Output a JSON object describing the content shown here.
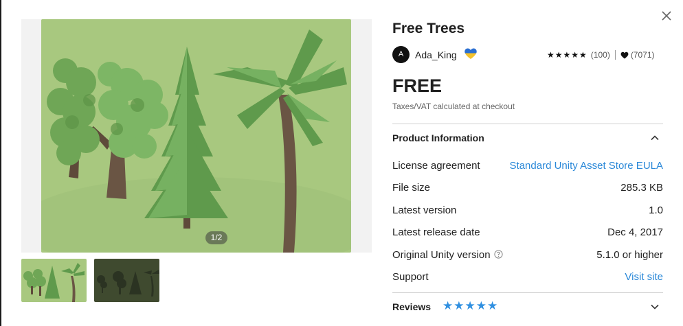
{
  "product": {
    "title": "Free Trees",
    "publisher": "Ada_King",
    "avatar_initial": "A",
    "rating_stars": "★★★★★",
    "rating_count": "(100)",
    "favorites_count": "(7071)",
    "price": "FREE",
    "tax_note": "Taxes/VAT calculated at checkout"
  },
  "gallery": {
    "counter": "1/2"
  },
  "product_information": {
    "heading": "Product Information",
    "rows": [
      {
        "label": "License agreement",
        "value": "Standard Unity Asset Store EULA"
      },
      {
        "label": "File size",
        "value": "285.3 KB"
      },
      {
        "label": "Latest version",
        "value": "1.0"
      },
      {
        "label": "Latest release date",
        "value": "Dec 4, 2017"
      },
      {
        "label": "Original Unity version",
        "value": "5.1.0 or higher"
      },
      {
        "label": "Support",
        "value": "Visit site"
      }
    ]
  },
  "reviews": {
    "heading": "Reviews",
    "stars": "★★★★★"
  },
  "icons": {
    "close": "close-icon",
    "flag": "ukraine-heart-icon",
    "heart": "heart-icon",
    "help": "help-icon",
    "chevron_up": "chevron-up-icon",
    "chevron_down": "chevron-down-icon"
  },
  "colors": {
    "link": "#2a88d8",
    "review_stars": "#2f8fe0",
    "image_background": "#a8c87f"
  }
}
